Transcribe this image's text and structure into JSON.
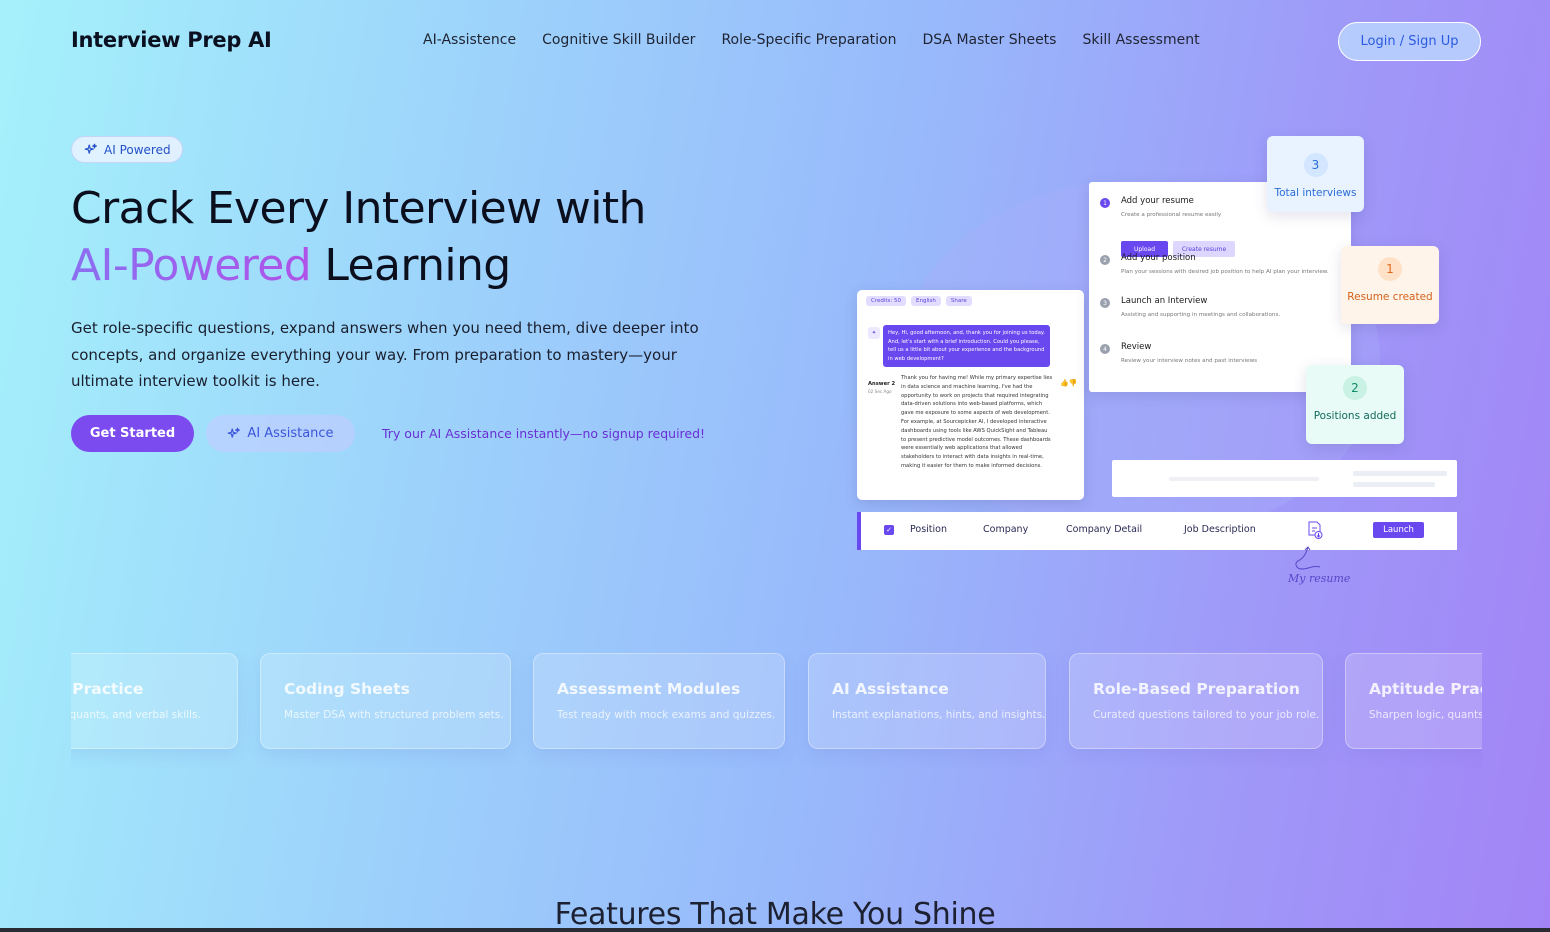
{
  "brand": "Interview Prep AI",
  "nav": [
    "AI-Assistence",
    "Cognitive Skill Builder",
    "Role-Specific Preparation",
    "DSA Master Sheets",
    "Skill Assessment"
  ],
  "login_label": "Login / Sign Up",
  "hero": {
    "badge": "AI Powered",
    "title_line1": "Crack Every Interview with",
    "title_highlight": "AI-Powered",
    "title_end": "Learning",
    "lead": "Get role-specific questions, expand answers when you need them, dive deeper into concepts, and organize everything your way. From preparation to mastery—your ultimate interview toolkit is here.",
    "primary_button": "Get Started",
    "secondary_button": "AI Assistance",
    "try_text": "Try our AI Assistance instantly—no signup required!"
  },
  "illustration": {
    "chips": [
      "Credits: 50",
      "English",
      "Share"
    ],
    "chat_question": "Hey, Hi, good afternoon, and, thank you for joining us today. And, let's start with a brief introduction. Could you please, tell us a little bit about your experience and the background in web development?",
    "answer_label": "Answer 2",
    "answer_sub": "02 Sec Ago",
    "answer_text": "Thank you for having me! While my primary expertise lies in data science and machine learning, I've had the opportunity to work on projects that required integrating data-driven solutions into web-based platforms, which gave me exposure to some aspects of web development. For example, at Sourcepicker AI, I developed interactive dashboards using tools like AWS QuickSight and Tableau to present predictive model outcomes. These dashboards were essentially web applications that allowed stakeholders to interact with data insights in real-time, making it easier for them to make informed decisions.",
    "steps": [
      {
        "num": "1",
        "title": "Add your resume",
        "desc": "Create a professional resume easily"
      },
      {
        "num": "2",
        "title": "Add your position",
        "desc": "Plan your sessions with desired job position to help AI plan your interview."
      },
      {
        "num": "3",
        "title": "Launch an Interview",
        "desc": "Assisting and supporting in meetings and collaborations."
      },
      {
        "num": "4",
        "title": "Review",
        "desc": "Review your interview notes and past interviews"
      }
    ],
    "upload_label": "Upload",
    "create_resume_label": "Create resume",
    "stats": [
      {
        "value": "3",
        "label": "Total interviews"
      },
      {
        "value": "1",
        "label": "Resume created"
      },
      {
        "value": "2",
        "label": "Positions added"
      }
    ],
    "table_columns": [
      "Position",
      "Company",
      "Company Detail",
      "Job Description"
    ],
    "launch_label": "Launch",
    "resume_note": "My resume"
  },
  "features": [
    {
      "title": "Aptitude Practice",
      "desc": "Sharpen logic, quants, and verbal skills."
    },
    {
      "title": "Coding Sheets",
      "desc": "Master DSA with structured problem sets."
    },
    {
      "title": "Assessment Modules",
      "desc": "Test ready with mock exams and quizzes."
    },
    {
      "title": "AI Assistance",
      "desc": "Instant explanations, hints, and insights."
    },
    {
      "title": "Role-Based Preparation",
      "desc": "Curated questions tailored to your job role."
    },
    {
      "title": "Aptitude Practice",
      "desc": "Sharpen logic, quants, and verbal skills."
    }
  ],
  "features_heading": "Features That Make You Shine"
}
